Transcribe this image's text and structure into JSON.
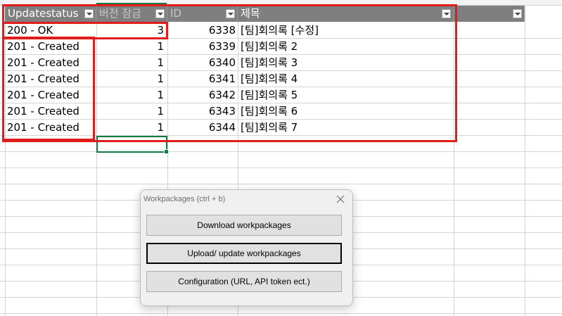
{
  "table": {
    "headers": [
      {
        "label": "Updatestatus"
      },
      {
        "label": "버전 잠금"
      },
      {
        "label": "ID"
      },
      {
        "label": "제목"
      },
      {
        "label": ""
      }
    ],
    "rows": [
      {
        "status": "200 - OK",
        "version": "3",
        "id": "6338",
        "title": "[팀]회의록 [수정]"
      },
      {
        "status": "201 - Created",
        "version": "1",
        "id": "6339",
        "title": "[팀]회의록 2"
      },
      {
        "status": "201 - Created",
        "version": "1",
        "id": "6340",
        "title": "[팀]회의록 3"
      },
      {
        "status": "201 - Created",
        "version": "1",
        "id": "6341",
        "title": "[팀]회의록 4"
      },
      {
        "status": "201 - Created",
        "version": "1",
        "id": "6342",
        "title": "[팀]회의록 5"
      },
      {
        "status": "201 - Created",
        "version": "1",
        "id": "6343",
        "title": "[팀]회의록 6"
      },
      {
        "status": "201 - Created",
        "version": "1",
        "id": "6344",
        "title": "[팀]회의록 7"
      }
    ]
  },
  "dialog": {
    "title": "Workpackages (ctrl + b)",
    "buttons": {
      "download": "Download workpackages",
      "upload": "Upload/ update workpackages",
      "config": "Configuration (URL, API token ect.)"
    }
  },
  "colors": {
    "header_bg": "#7f7f7f",
    "highlight": "#e21b1b",
    "selection": "#107c41"
  },
  "icons": {
    "filter": "dropdown-filter-icon",
    "close": "close-icon"
  }
}
